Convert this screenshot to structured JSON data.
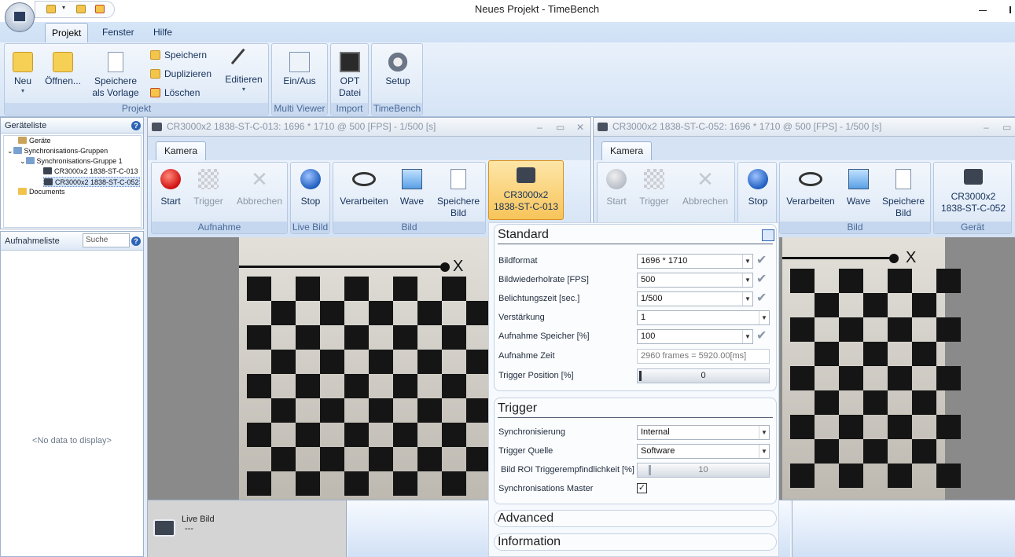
{
  "window": {
    "title": "Neues Projekt - TimeBench"
  },
  "ribbon": {
    "tabs": [
      "Projekt",
      "Fenster",
      "Hilfe"
    ],
    "groups": {
      "projekt": {
        "title": "Projekt",
        "neu": "Neu",
        "oeffnen": "Öffnen...",
        "speichere_vorlage_1": "Speichere",
        "speichere_vorlage_2": "als Vorlage",
        "speichern": "Speichern",
        "duplizieren": "Duplizieren",
        "loeschen": "Löschen",
        "editieren": "Editieren"
      },
      "multiviewer": {
        "title": "Multi Viewer",
        "einaus": "Ein/Aus"
      },
      "import": {
        "title": "Import",
        "opt1": "OPT",
        "opt2": "Datei"
      },
      "timebench": {
        "title": "TimeBench",
        "setup": "Setup"
      }
    }
  },
  "geraeteliste": {
    "title": "Geräteliste",
    "tree": [
      {
        "label": "Geräte"
      },
      {
        "label": "Synchronisations-Gruppen"
      },
      {
        "label": "Synchronisations-Gruppe 1"
      },
      {
        "label": "CR3000x2 1838-ST-C-013"
      },
      {
        "label": "CR3000x2 1838-ST-C-052"
      },
      {
        "label": "Documents"
      }
    ]
  },
  "aufnahmeliste": {
    "title": "Aufnahmeliste",
    "search_placeholder": "Suche",
    "empty": "<No data to display>"
  },
  "viewer1": {
    "title": "CR3000x2 1838-ST-C-013: 1696 * 1710 @ 500 [FPS] - 1/500 [s]",
    "tab": "Kamera",
    "start": "Start",
    "trigger": "Trigger",
    "abbrechen": "Abbrechen",
    "aufnahme": "Aufnahme",
    "stop": "Stop",
    "livebild": "Live Bild",
    "verarbeiten": "Verarbeiten",
    "wave": "Wave",
    "speichere1": "Speichere",
    "speichere2": "Bild",
    "bild": "Bild",
    "cam1": "CR3000x2",
    "cam2": "1838-ST-C-013",
    "x_label": "X",
    "live_label": "Live Bild",
    "live_value": "---"
  },
  "viewer2": {
    "title": "CR3000x2 1838-ST-C-052: 1696 * 1710 @ 500 [FPS] - 1/500 [s]",
    "tab": "Kamera",
    "start": "Start",
    "trigger": "Trigger",
    "abbrechen": "Abbrechen",
    "stop": "Stop",
    "verarbeiten": "Verarbeiten",
    "wave": "Wave",
    "speichere1": "Speichere",
    "speichere2": "Bild",
    "bild": "Bild",
    "cam1": "CR3000x2",
    "cam2": "1838-ST-C-052",
    "geraet": "Gerät",
    "x_label": "X"
  },
  "properties": {
    "standard": {
      "title": "Standard",
      "bildformat_label": "Bildformat",
      "bildformat": "1696 * 1710",
      "fps_label": "Bildwiederholrate [FPS]",
      "fps": "500",
      "belicht_label": "Belichtungszeit [sec.]",
      "belicht": "1/500",
      "verst_label": "Verstärkung",
      "verst": "1",
      "speicher_label": "Aufnahme Speicher [%]",
      "speicher": "100",
      "zeit_label": "Aufnahme Zeit",
      "zeit": "2960 frames = 5920.00[ms]",
      "trigpos_label": "Trigger Position [%]",
      "trigpos": "0"
    },
    "trigger": {
      "title": "Trigger",
      "sync_label": "Synchronisierung",
      "sync": "Internal",
      "quelle_label": "Trigger Quelle",
      "quelle": "Software",
      "roi_label": "Bild ROI Triggerempfindlichkeit [%]",
      "roi": "10",
      "master_label": "Synchronisations Master",
      "master": "✓"
    },
    "advanced": "Advanced",
    "information": "Information"
  }
}
